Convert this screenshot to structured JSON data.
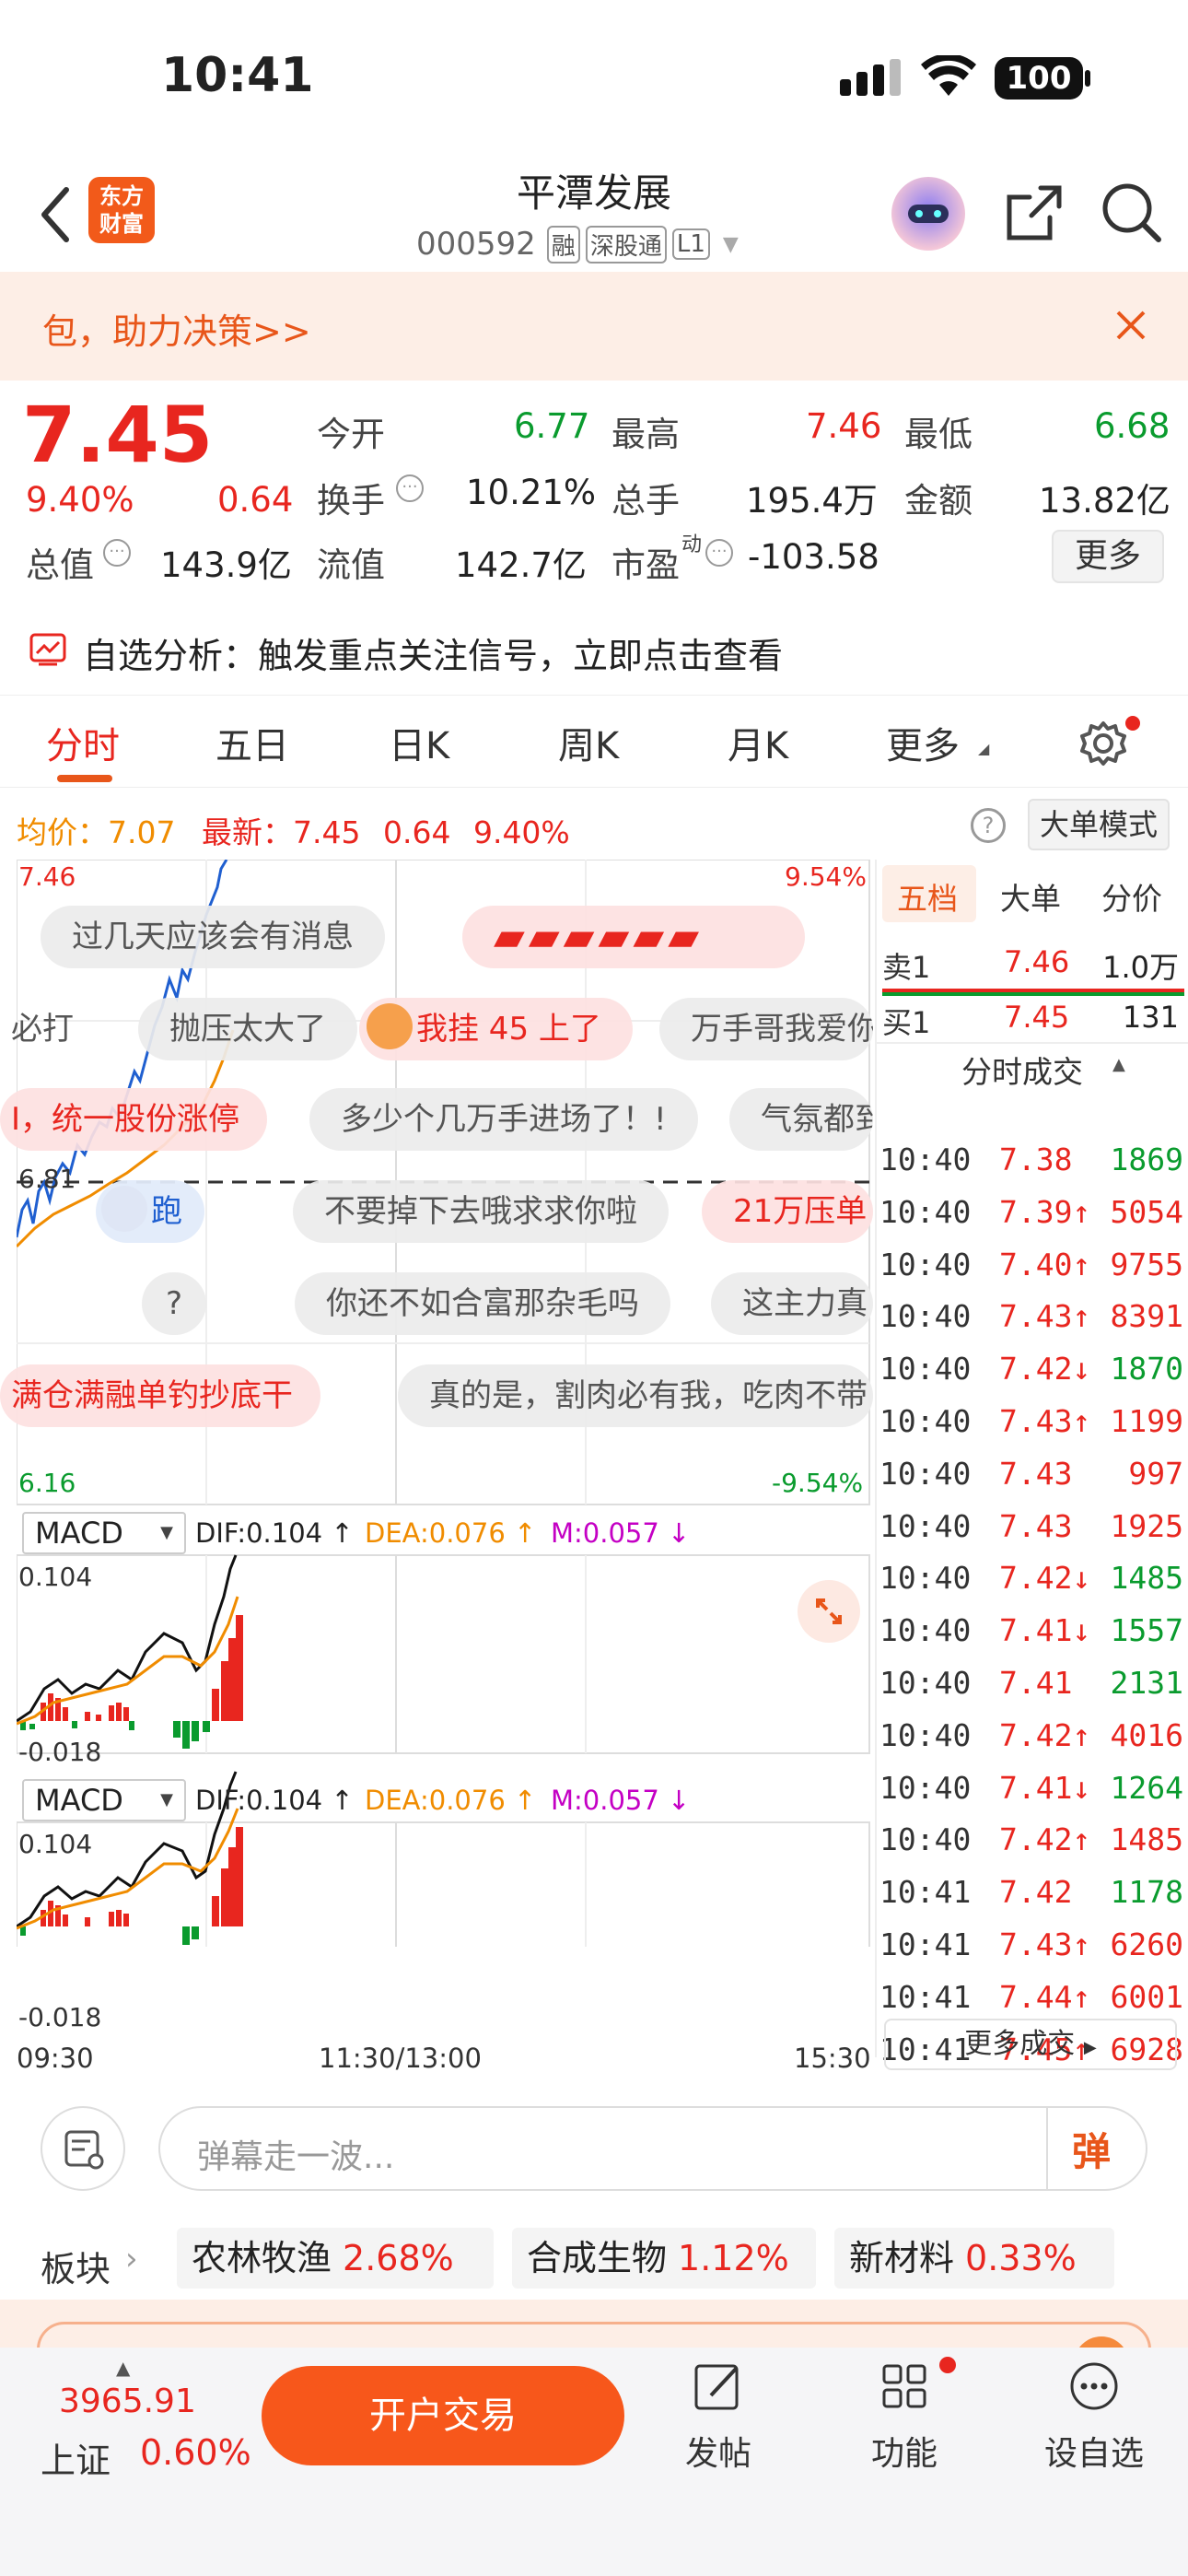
{
  "status": {
    "time": "10:41",
    "battery": "100"
  },
  "header": {
    "logo_line1": "东方",
    "logo_line2": "财富",
    "title": "平潭发展",
    "code": "000592",
    "tags": [
      "融",
      "深股通",
      "L1"
    ]
  },
  "banner": {
    "text": "包，助力决策>>"
  },
  "quote": {
    "price": "7.45",
    "pct": "9.40%",
    "chg": "0.64",
    "zongzhi_label": "总值",
    "zongzhi": "143.9亿",
    "jinkai_label": "今开",
    "jinkai": "6.77",
    "zuigao_label": "最高",
    "zuigao": "7.46",
    "zuidi_label": "最低",
    "zuidi": "6.68",
    "huanshou_label": "换手",
    "huanshou": "10.21%",
    "zongshou_label": "总手",
    "zongshou": "195.4万",
    "jine_label": "金额",
    "jine": "13.82亿",
    "liuzhi_label": "流值",
    "liuzhi": "142.7亿",
    "shiying_label": "市盈",
    "shiying_sup": "动",
    "shiying": "-103.58",
    "more": "更多"
  },
  "notice": {
    "text": "自选分析：触发重点关注信号，立即点击查看"
  },
  "tabs": [
    "分时",
    "五日",
    "日K",
    "周K",
    "月K",
    "更多"
  ],
  "chart": {
    "avg_label": "均价：",
    "avg": "7.07",
    "latest_label": "最新：",
    "latest": "7.45",
    "latest_chg": "0.64",
    "latest_pct": "9.40%",
    "big_order_mode": "大单模式",
    "y_top": "7.46",
    "y_mid": "6.81",
    "y_bottom": "6.16",
    "pct_top": "9.54%",
    "pct_bottom": "-9.54%",
    "x_labels": [
      "09:30",
      "11:30/13:00",
      "15:30"
    ],
    "macd1": {
      "name": "MACD",
      "dif": "DIF:0.104 ↑",
      "dea": "DEA:0.076 ↑",
      "m": "M:0.057 ↓",
      "top": "0.104",
      "bottom": "-0.018"
    },
    "macd2": {
      "name": "MACD",
      "dif": "DIF:0.104 ↑",
      "dea": "DEA:0.076 ↑",
      "m": "M:0.057 ↓",
      "top": "0.104",
      "bottom": "-0.018"
    }
  },
  "danmu": [
    "过几天应该会有消息",
    "必打",
    "抛压太大了",
    "我挂 45 上了",
    "万手哥我爱你",
    "I，统一股份涨停",
    "多少个几万手进场了！!",
    "气氛都到",
    "跑",
    "不要掉下去哦求求你啦",
    "21万压单",
    "?",
    "你还不如合富那杂毛吗",
    "这主力真",
    "满仓满融单钓抄底干",
    "真的是，割肉必有我，吃肉不带"
  ],
  "orderbook": {
    "tabs": [
      "五档",
      "大单",
      "分价"
    ],
    "sell1_label": "卖1",
    "sell1_price": "7.46",
    "sell1_vol": "1.0万",
    "buy1_label": "买1",
    "buy1_price": "7.45",
    "buy1_vol": "131",
    "trades_title": "分时成交",
    "trades": [
      {
        "t": "10:40",
        "p": "7.38",
        "v": "1869",
        "pc": "red",
        "vc": "green"
      },
      {
        "t": "10:40",
        "p": "7.39↑",
        "v": "5054",
        "pc": "red",
        "vc": "red"
      },
      {
        "t": "10:40",
        "p": "7.40↑",
        "v": "9755",
        "pc": "red",
        "vc": "red"
      },
      {
        "t": "10:40",
        "p": "7.43↑",
        "v": "8391",
        "pc": "red",
        "vc": "red"
      },
      {
        "t": "10:40",
        "p": "7.42↓",
        "v": "1870",
        "pc": "red",
        "vc": "green"
      },
      {
        "t": "10:40",
        "p": "7.43↑",
        "v": "1199",
        "pc": "red",
        "vc": "red"
      },
      {
        "t": "10:40",
        "p": "7.43",
        "v": "997",
        "pc": "red",
        "vc": "red"
      },
      {
        "t": "10:40",
        "p": "7.43",
        "v": "1925",
        "pc": "red",
        "vc": "red"
      },
      {
        "t": "10:40",
        "p": "7.42↓",
        "v": "1485",
        "pc": "red",
        "vc": "green"
      },
      {
        "t": "10:40",
        "p": "7.41↓",
        "v": "1557",
        "pc": "red",
        "vc": "green"
      },
      {
        "t": "10:40",
        "p": "7.41",
        "v": "2131",
        "pc": "red",
        "vc": "green"
      },
      {
        "t": "10:40",
        "p": "7.42↑",
        "v": "4016",
        "pc": "red",
        "vc": "red"
      },
      {
        "t": "10:40",
        "p": "7.41↓",
        "v": "1264",
        "pc": "red",
        "vc": "green"
      },
      {
        "t": "10:40",
        "p": "7.42↑",
        "v": "1485",
        "pc": "red",
        "vc": "red"
      },
      {
        "t": "10:41",
        "p": "7.42",
        "v": "1178",
        "pc": "red",
        "vc": "green"
      },
      {
        "t": "10:41",
        "p": "7.43↑",
        "v": "6260",
        "pc": "red",
        "vc": "red"
      },
      {
        "t": "10:41",
        "p": "7.44↑",
        "v": "6001",
        "pc": "red",
        "vc": "red"
      },
      {
        "t": "10:41",
        "p": "7.45↑",
        "v": "6928",
        "pc": "red",
        "vc": "red"
      }
    ],
    "more_trades": "更多成交"
  },
  "comment": {
    "placeholder": "弹幕走一波...",
    "danmu_btn": "弹"
  },
  "sectors": {
    "label": "板块",
    "items": [
      {
        "name": "农林牧渔",
        "pct": "2.68%"
      },
      {
        "name": "合成生物",
        "pct": "1.12%"
      },
      {
        "name": "新材料",
        "pct": "0.33%"
      }
    ]
  },
  "bottom": {
    "index_value": "3965.91",
    "index_name": "上证",
    "index_pct": "0.60%",
    "trade_btn": "开户交易",
    "post": "发帖",
    "func": "功能",
    "watch": "设自选"
  },
  "colors": {
    "up": "#e8261f",
    "down": "#0a9b2e",
    "accent": "#ff6a00",
    "avg_line": "#f08c00",
    "price_line": "#1f5fd0"
  }
}
